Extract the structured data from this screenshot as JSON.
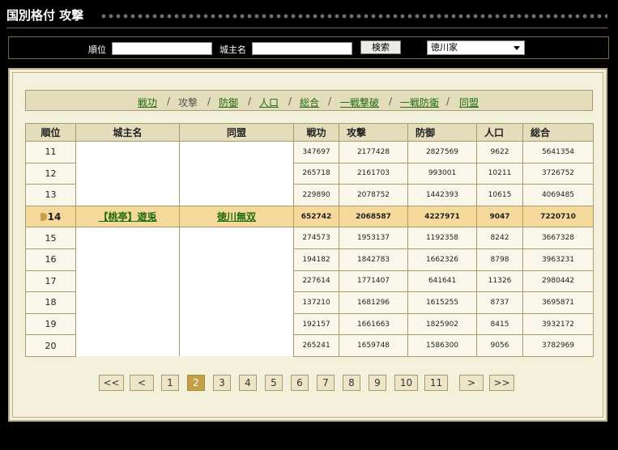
{
  "header": {
    "title": "国別格付 攻撃"
  },
  "search": {
    "rank_label": "順位",
    "rank_value": "",
    "owner_label": "城主名",
    "owner_value": "",
    "search_button": "検索",
    "country_selected": "徳川家"
  },
  "categories": [
    {
      "label": "戦功",
      "current": false
    },
    {
      "label": "攻撃",
      "current": true
    },
    {
      "label": "防御",
      "current": false
    },
    {
      "label": "人口",
      "current": false
    },
    {
      "label": "総合",
      "current": false
    },
    {
      "label": "一戦撃破",
      "current": false
    },
    {
      "label": "一戦防衛",
      "current": false
    },
    {
      "label": "同盟",
      "current": false
    }
  ],
  "table": {
    "headers": [
      "順位",
      "城主名",
      "同盟",
      "戦功",
      "攻撃",
      "防御",
      "人口",
      "総合"
    ],
    "rows": [
      {
        "rank": "11",
        "owner": "",
        "alliance": "",
        "senko": "347697",
        "attack": "2177428",
        "defense": "2827569",
        "population": "9622",
        "total": "5641354"
      },
      {
        "rank": "12",
        "owner": "",
        "alliance": "",
        "senko": "265718",
        "attack": "2161703",
        "defense": "993001",
        "population": "10211",
        "total": "3726752"
      },
      {
        "rank": "13",
        "owner": "",
        "alliance": "",
        "senko": "229890",
        "attack": "2078752",
        "defense": "1442393",
        "population": "10615",
        "total": "4069485"
      },
      {
        "rank": "14",
        "owner": "【桃亭】遊兎",
        "alliance": "徳川無双",
        "senko": "652742",
        "attack": "2068587",
        "defense": "4227971",
        "population": "9047",
        "total": "7220710",
        "highlight": true
      },
      {
        "rank": "15",
        "owner": "",
        "alliance": "",
        "senko": "274573",
        "attack": "1953137",
        "defense": "1192358",
        "population": "8242",
        "total": "3667328"
      },
      {
        "rank": "16",
        "owner": "",
        "alliance": "",
        "senko": "194182",
        "attack": "1842783",
        "defense": "1662326",
        "population": "8798",
        "total": "3963231"
      },
      {
        "rank": "17",
        "owner": "",
        "alliance": "",
        "senko": "227614",
        "attack": "1771407",
        "defense": "641641",
        "population": "11326",
        "total": "2980442"
      },
      {
        "rank": "18",
        "owner": "",
        "alliance": "",
        "senko": "137210",
        "attack": "1681296",
        "defense": "1615255",
        "population": "8737",
        "total": "3695871"
      },
      {
        "rank": "19",
        "owner": "",
        "alliance": "",
        "senko": "192157",
        "attack": "1661663",
        "defense": "1825902",
        "population": "8415",
        "total": "3932172"
      },
      {
        "rank": "20",
        "owner": "",
        "alliance": "",
        "senko": "265241",
        "attack": "1659748",
        "defense": "1586300",
        "population": "9056",
        "total": "3782969"
      }
    ]
  },
  "pagination": {
    "first": "<<",
    "prev": "<",
    "pages": [
      "1",
      "2",
      "3",
      "4",
      "5",
      "6",
      "7",
      "8",
      "9",
      "10",
      "11"
    ],
    "current": "2",
    "next": ">",
    "last": ">>"
  },
  "colors": {
    "panel_bg": "#f3f0dc",
    "header_bg": "#e4ddbb",
    "highlight_row": "#f5d99a",
    "link_green": "#1d6a10",
    "active_page": "#c4a048"
  }
}
